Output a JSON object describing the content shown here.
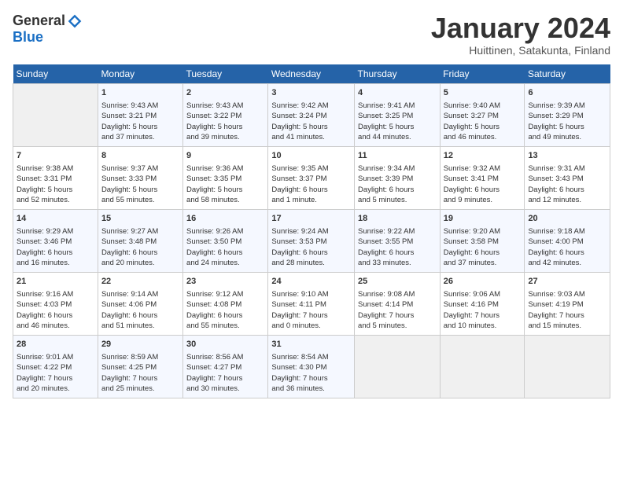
{
  "header": {
    "logo_general": "General",
    "logo_blue": "Blue",
    "month_title": "January 2024",
    "subtitle": "Huittinen, Satakunta, Finland"
  },
  "days_of_week": [
    "Sunday",
    "Monday",
    "Tuesday",
    "Wednesday",
    "Thursday",
    "Friday",
    "Saturday"
  ],
  "weeks": [
    [
      {
        "day": "",
        "info": ""
      },
      {
        "day": "1",
        "info": "Sunrise: 9:43 AM\nSunset: 3:21 PM\nDaylight: 5 hours\nand 37 minutes."
      },
      {
        "day": "2",
        "info": "Sunrise: 9:43 AM\nSunset: 3:22 PM\nDaylight: 5 hours\nand 39 minutes."
      },
      {
        "day": "3",
        "info": "Sunrise: 9:42 AM\nSunset: 3:24 PM\nDaylight: 5 hours\nand 41 minutes."
      },
      {
        "day": "4",
        "info": "Sunrise: 9:41 AM\nSunset: 3:25 PM\nDaylight: 5 hours\nand 44 minutes."
      },
      {
        "day": "5",
        "info": "Sunrise: 9:40 AM\nSunset: 3:27 PM\nDaylight: 5 hours\nand 46 minutes."
      },
      {
        "day": "6",
        "info": "Sunrise: 9:39 AM\nSunset: 3:29 PM\nDaylight: 5 hours\nand 49 minutes."
      }
    ],
    [
      {
        "day": "7",
        "info": "Sunrise: 9:38 AM\nSunset: 3:31 PM\nDaylight: 5 hours\nand 52 minutes."
      },
      {
        "day": "8",
        "info": "Sunrise: 9:37 AM\nSunset: 3:33 PM\nDaylight: 5 hours\nand 55 minutes."
      },
      {
        "day": "9",
        "info": "Sunrise: 9:36 AM\nSunset: 3:35 PM\nDaylight: 5 hours\nand 58 minutes."
      },
      {
        "day": "10",
        "info": "Sunrise: 9:35 AM\nSunset: 3:37 PM\nDaylight: 6 hours\nand 1 minute."
      },
      {
        "day": "11",
        "info": "Sunrise: 9:34 AM\nSunset: 3:39 PM\nDaylight: 6 hours\nand 5 minutes."
      },
      {
        "day": "12",
        "info": "Sunrise: 9:32 AM\nSunset: 3:41 PM\nDaylight: 6 hours\nand 9 minutes."
      },
      {
        "day": "13",
        "info": "Sunrise: 9:31 AM\nSunset: 3:43 PM\nDaylight: 6 hours\nand 12 minutes."
      }
    ],
    [
      {
        "day": "14",
        "info": "Sunrise: 9:29 AM\nSunset: 3:46 PM\nDaylight: 6 hours\nand 16 minutes."
      },
      {
        "day": "15",
        "info": "Sunrise: 9:27 AM\nSunset: 3:48 PM\nDaylight: 6 hours\nand 20 minutes."
      },
      {
        "day": "16",
        "info": "Sunrise: 9:26 AM\nSunset: 3:50 PM\nDaylight: 6 hours\nand 24 minutes."
      },
      {
        "day": "17",
        "info": "Sunrise: 9:24 AM\nSunset: 3:53 PM\nDaylight: 6 hours\nand 28 minutes."
      },
      {
        "day": "18",
        "info": "Sunrise: 9:22 AM\nSunset: 3:55 PM\nDaylight: 6 hours\nand 33 minutes."
      },
      {
        "day": "19",
        "info": "Sunrise: 9:20 AM\nSunset: 3:58 PM\nDaylight: 6 hours\nand 37 minutes."
      },
      {
        "day": "20",
        "info": "Sunrise: 9:18 AM\nSunset: 4:00 PM\nDaylight: 6 hours\nand 42 minutes."
      }
    ],
    [
      {
        "day": "21",
        "info": "Sunrise: 9:16 AM\nSunset: 4:03 PM\nDaylight: 6 hours\nand 46 minutes."
      },
      {
        "day": "22",
        "info": "Sunrise: 9:14 AM\nSunset: 4:06 PM\nDaylight: 6 hours\nand 51 minutes."
      },
      {
        "day": "23",
        "info": "Sunrise: 9:12 AM\nSunset: 4:08 PM\nDaylight: 6 hours\nand 55 minutes."
      },
      {
        "day": "24",
        "info": "Sunrise: 9:10 AM\nSunset: 4:11 PM\nDaylight: 7 hours\nand 0 minutes."
      },
      {
        "day": "25",
        "info": "Sunrise: 9:08 AM\nSunset: 4:14 PM\nDaylight: 7 hours\nand 5 minutes."
      },
      {
        "day": "26",
        "info": "Sunrise: 9:06 AM\nSunset: 4:16 PM\nDaylight: 7 hours\nand 10 minutes."
      },
      {
        "day": "27",
        "info": "Sunrise: 9:03 AM\nSunset: 4:19 PM\nDaylight: 7 hours\nand 15 minutes."
      }
    ],
    [
      {
        "day": "28",
        "info": "Sunrise: 9:01 AM\nSunset: 4:22 PM\nDaylight: 7 hours\nand 20 minutes."
      },
      {
        "day": "29",
        "info": "Sunrise: 8:59 AM\nSunset: 4:25 PM\nDaylight: 7 hours\nand 25 minutes."
      },
      {
        "day": "30",
        "info": "Sunrise: 8:56 AM\nSunset: 4:27 PM\nDaylight: 7 hours\nand 30 minutes."
      },
      {
        "day": "31",
        "info": "Sunrise: 8:54 AM\nSunset: 4:30 PM\nDaylight: 7 hours\nand 36 minutes."
      },
      {
        "day": "",
        "info": ""
      },
      {
        "day": "",
        "info": ""
      },
      {
        "day": "",
        "info": ""
      }
    ]
  ]
}
